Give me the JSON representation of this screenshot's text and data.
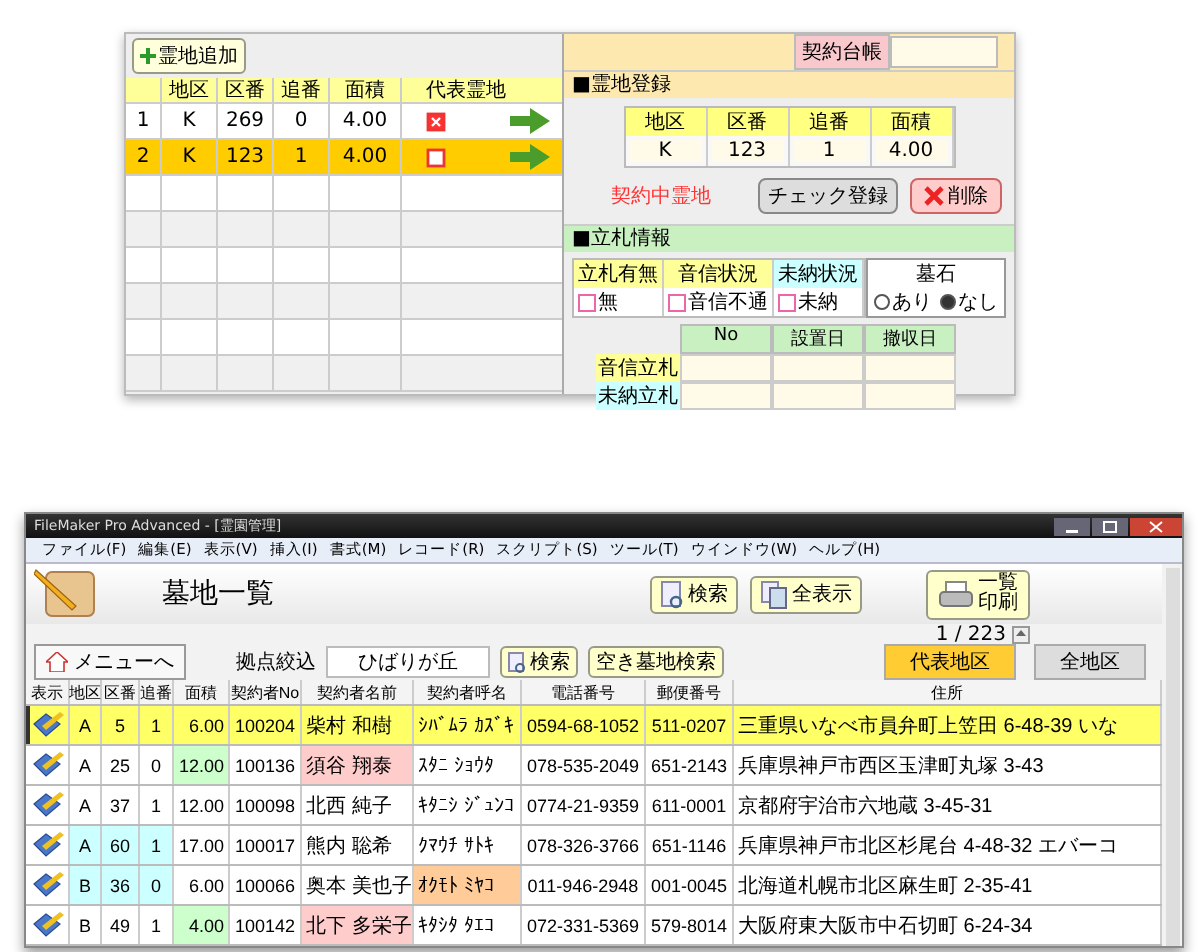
{
  "lot_panel": {
    "add_button": "霊地追加",
    "columns": [
      "地区",
      "区番",
      "追番",
      "面積",
      "代表霊地"
    ],
    "rows": [
      {
        "no": "1",
        "district": "K",
        "block": "269",
        "sub": "0",
        "area": "4.00",
        "representative": true,
        "selected": false
      },
      {
        "no": "2",
        "district": "K",
        "block": "123",
        "sub": "1",
        "area": "4.00",
        "representative": false,
        "selected": true
      }
    ]
  },
  "contract_field": {
    "label": "契約台帳"
  },
  "lot_registration": {
    "title": "■霊地登録",
    "columns": [
      "地区",
      "区番",
      "追番",
      "面積"
    ],
    "values": [
      "K",
      "123",
      "1",
      "4.00"
    ],
    "status": "契約中霊地",
    "check_button": "チェック登録",
    "delete_button": "削除"
  },
  "sign_info": {
    "title": "■立札情報",
    "statuses": [
      {
        "label": "立札有無",
        "option": "無",
        "checked": false,
        "color": "#ffff99"
      },
      {
        "label": "音信状況",
        "option": "音信不通",
        "checked": false,
        "color": "#ffff99"
      },
      {
        "label": "未納状況",
        "option": "未納",
        "checked": false,
        "color": "#ccffff"
      }
    ],
    "gravestone": {
      "label": "墓石",
      "options": [
        {
          "label": "あり",
          "selected": false
        },
        {
          "label": "なし",
          "selected": true
        }
      ]
    },
    "sign_table": {
      "columns": [
        "No",
        "設置日",
        "撤収日"
      ],
      "rows": [
        {
          "label": "音信立札",
          "color": "#ffff99"
        },
        {
          "label": "未納立札",
          "color": "#ccffff"
        }
      ]
    }
  },
  "app_window": {
    "title": "FileMaker Pro Advanced - [霊園管理]",
    "menu": [
      "ファイル(F)",
      "編集(E)",
      "表示(V)",
      "挿入(I)",
      "書式(M)",
      "レコード(R)",
      "スクリプト(S)",
      "ツール(T)",
      "ウインドウ(W)",
      "ヘルプ(H)"
    ],
    "heading": "墓地一覧",
    "search_button": "検索",
    "show_all_button": "全表示",
    "print_button": [
      "一覧",
      "印刷"
    ],
    "record_count": "1 / 223",
    "menu_button": "メニューへ",
    "filter_label": "拠点絞込",
    "filter_value": "ひばりが丘",
    "filter_search": "検索",
    "vacant_search": "空き墓地検索",
    "district_tabs": [
      {
        "label": "代表地区",
        "selected": true
      },
      {
        "label": "全地区",
        "selected": false
      }
    ],
    "columns": [
      "表示",
      "地区",
      "区番",
      "追番",
      "面積",
      "契約者No",
      "契約者名前",
      "契約者呼名",
      "電話番号",
      "郵便番号",
      "住所"
    ],
    "rows": [
      {
        "district": "A",
        "block": "5",
        "sub": "1",
        "area": "6.00",
        "contract_no": "100204",
        "name": "柴村 和樹",
        "kana": "ｼﾊﾞﾑﾗ ｶｽﾞｷ",
        "phone": "0594-68-1052",
        "zip": "511-0207",
        "address": "三重県いなべ市員弁町上笠田 6-48-39 いな",
        "selected": true,
        "lot_marked": false,
        "area_marked": false,
        "name_marked": false,
        "kana_marked": false
      },
      {
        "district": "A",
        "block": "25",
        "sub": "0",
        "area": "12.00",
        "contract_no": "100136",
        "name": "須谷 翔泰",
        "kana": "ｽﾀﾆ ｼｮｳﾀ",
        "phone": "078-535-2049",
        "zip": "651-2143",
        "address": "兵庫県神戸市西区玉津町丸塚 3-43",
        "selected": false,
        "lot_marked": false,
        "area_marked": true,
        "name_marked": true,
        "kana_marked": false
      },
      {
        "district": "A",
        "block": "37",
        "sub": "1",
        "area": "12.00",
        "contract_no": "100098",
        "name": "北西 純子",
        "kana": "ｷﾀﾆｼ ｼﾞｭﾝｺ",
        "phone": "0774-21-9359",
        "zip": "611-0001",
        "address": "京都府宇治市六地蔵 3-45-31",
        "selected": false,
        "lot_marked": false,
        "area_marked": false,
        "name_marked": false,
        "kana_marked": false
      },
      {
        "district": "A",
        "block": "60",
        "sub": "1",
        "area": "17.00",
        "contract_no": "100017",
        "name": "熊内 聡希",
        "kana": "ｸﾏｳﾁ ｻﾄｷ",
        "phone": "078-326-3766",
        "zip": "651-1146",
        "address": "兵庫県神戸市北区杉尾台 4-48-32 エバーコ",
        "selected": false,
        "lot_marked": true,
        "area_marked": false,
        "name_marked": false,
        "kana_marked": false
      },
      {
        "district": "B",
        "block": "36",
        "sub": "0",
        "area": "6.00",
        "contract_no": "100066",
        "name": "奥本 美也子",
        "kana": "ｵｸﾓﾄ ﾐﾔｺ",
        "phone": "011-946-2948",
        "zip": "001-0045",
        "address": "北海道札幌市北区麻生町 2-35-41",
        "selected": false,
        "lot_marked": true,
        "area_marked": false,
        "name_marked": false,
        "kana_marked": true
      },
      {
        "district": "B",
        "block": "49",
        "sub": "1",
        "area": "4.00",
        "contract_no": "100142",
        "name": "北下 多栄子",
        "kana": "ｷﾀｼﾀ ﾀｴｺ",
        "phone": "072-331-5369",
        "zip": "579-8014",
        "address": "大阪府東大阪市中石切町 6-24-34",
        "selected": false,
        "lot_marked": false,
        "area_marked": true,
        "name_marked": true,
        "kana_marked": false
      }
    ]
  }
}
